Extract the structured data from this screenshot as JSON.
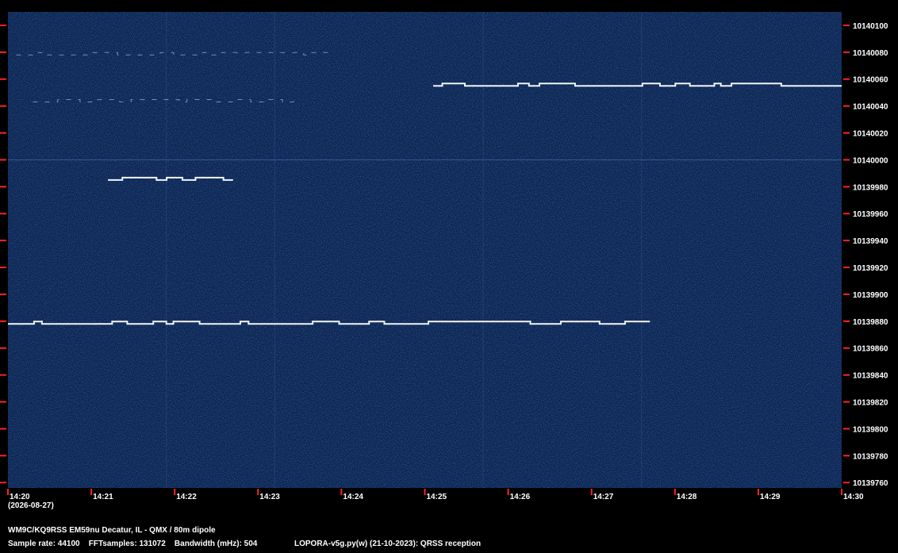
{
  "chart_data": {
    "type": "heatmap",
    "title": "",
    "x_axis": {
      "ticks": [
        "14:20",
        "14:21",
        "14:22",
        "14:23",
        "14:24",
        "14:25",
        "14:26",
        "14:27",
        "14:28",
        "14:29",
        "14:30"
      ],
      "date_label": "(2026-08-27)",
      "range": [
        "14:20",
        "14:30"
      ]
    },
    "y_axis": {
      "unit": "Hz",
      "ticks": [
        10140100,
        10140080,
        10140060,
        10140040,
        10140020,
        10140000,
        10139980,
        10139960,
        10139940,
        10139920,
        10139900,
        10139880,
        10139860,
        10139840,
        10139820,
        10139800,
        10139780,
        10139760
      ],
      "range": [
        10139756,
        10140110
      ]
    },
    "colors": {
      "background": "#0b1f4a",
      "signal": "#ffffff",
      "tick": "#ff2222",
      "frame": "#000000"
    },
    "traces": [
      {
        "freq_hz": 10139878,
        "start": "14:20",
        "end": "14:27.7",
        "style": "fsk-cw"
      },
      {
        "freq_hz": 10140055,
        "start": "14:25.1",
        "end": "14:30",
        "style": "fsk-cw"
      },
      {
        "freq_hz": 10139985,
        "start": "14:21.2",
        "end": "14:22.7",
        "style": "fsk-cw"
      },
      {
        "freq_hz": 10140078,
        "start": "14:20.1",
        "end": "14:23.9",
        "style": "faint"
      },
      {
        "freq_hz": 10140043,
        "start": "14:20.3",
        "end": "14:23.5",
        "style": "faint"
      },
      {
        "freq_hz": 10140000,
        "start": "14:20",
        "end": "14:30",
        "style": "carrier"
      }
    ]
  },
  "footer": {
    "station": "WM9C/KQ9RSS EM59nu Decatur, IL - QMX / 80m dipole",
    "params": "Sample rate: 44100    FFTsamples: 131072    Bandwidth (mHz): 504",
    "software": "LOPORA-v5g.py(w) (21-10-2023): QRSS reception"
  }
}
